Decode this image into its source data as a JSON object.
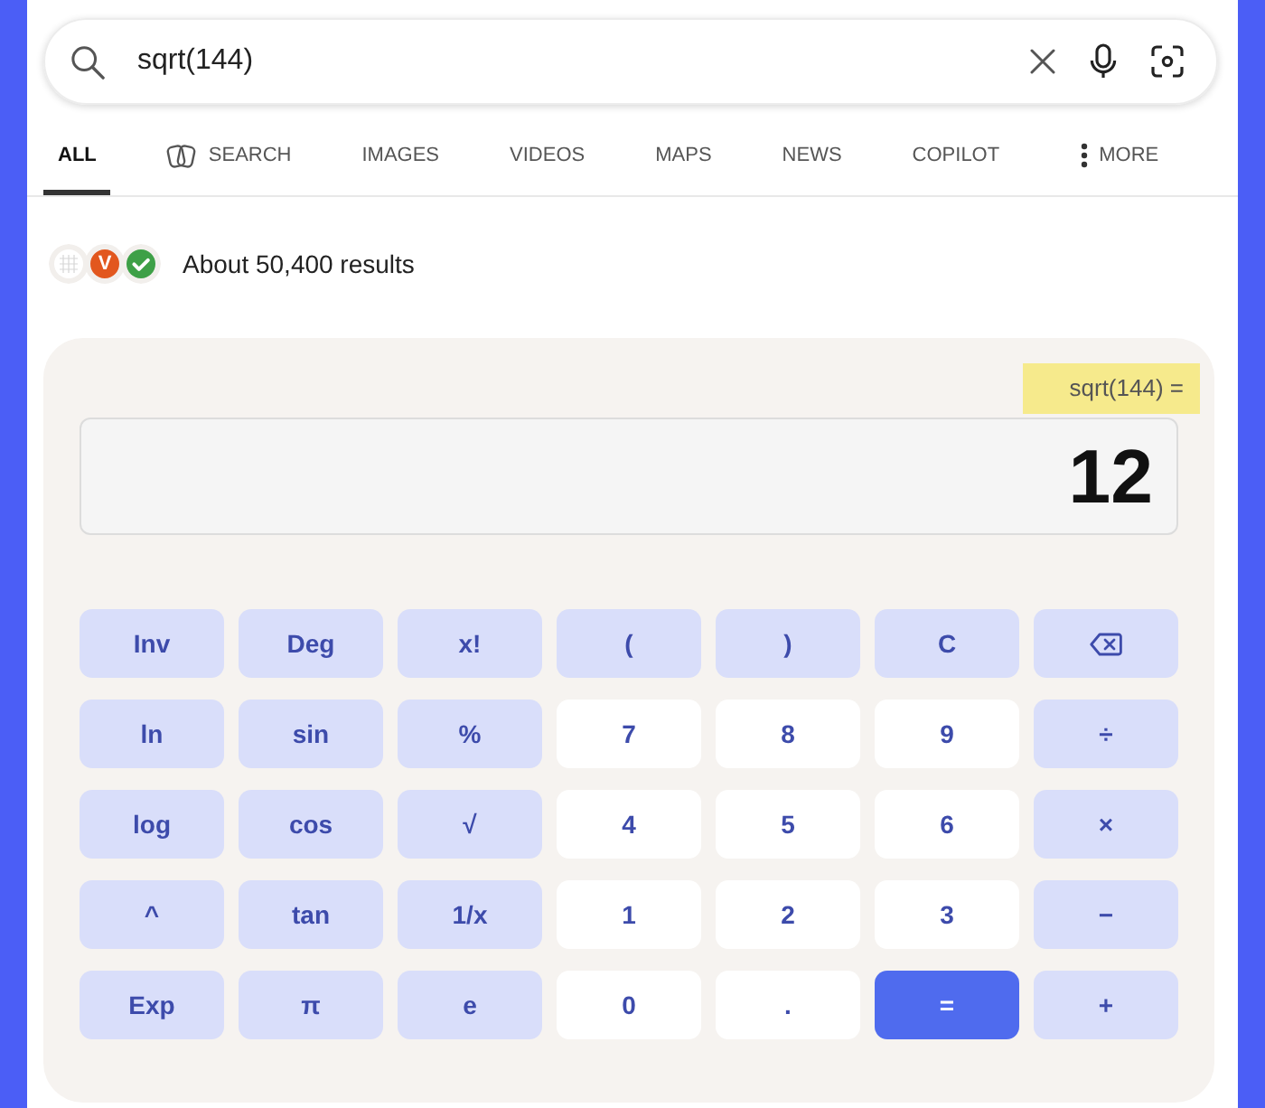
{
  "search": {
    "value": "sqrt(144)"
  },
  "tabs": [
    {
      "label": "ALL",
      "kind": "text",
      "selected": true
    },
    {
      "label": "SEARCH",
      "kind": "search",
      "selected": false
    },
    {
      "label": "IMAGES",
      "kind": "text",
      "selected": false
    },
    {
      "label": "VIDEOS",
      "kind": "text",
      "selected": false
    },
    {
      "label": "MAPS",
      "kind": "text",
      "selected": false
    },
    {
      "label": "NEWS",
      "kind": "text",
      "selected": false
    },
    {
      "label": "COPILOT",
      "kind": "text",
      "selected": false
    },
    {
      "label": "MORE",
      "kind": "more",
      "selected": false
    }
  ],
  "results": {
    "sources": [
      {
        "kind": "grid"
      },
      {
        "kind": "letter",
        "label": "V"
      },
      {
        "kind": "check"
      }
    ],
    "count": "About 50,400 results"
  },
  "calculator": {
    "expression": "sqrt(144) =",
    "result": "12",
    "keys": [
      {
        "label": "Inv",
        "kind": "function"
      },
      {
        "label": "Deg",
        "kind": "function"
      },
      {
        "label": "x!",
        "kind": "function"
      },
      {
        "label": "(",
        "kind": "function"
      },
      {
        "label": ")",
        "kind": "function"
      },
      {
        "label": "C",
        "kind": "function"
      },
      {
        "kind": "backspace"
      },
      {
        "label": "ln",
        "kind": "function"
      },
      {
        "label": "sin",
        "kind": "function"
      },
      {
        "label": "%",
        "kind": "function"
      },
      {
        "label": "7",
        "kind": "digit"
      },
      {
        "label": "8",
        "kind": "digit"
      },
      {
        "label": "9",
        "kind": "digit"
      },
      {
        "label": "÷",
        "kind": "function"
      },
      {
        "label": "log",
        "kind": "function"
      },
      {
        "label": "cos",
        "kind": "function"
      },
      {
        "label": "√",
        "kind": "function"
      },
      {
        "label": "4",
        "kind": "digit"
      },
      {
        "label": "5",
        "kind": "digit"
      },
      {
        "label": "6",
        "kind": "digit"
      },
      {
        "label": "×",
        "kind": "function"
      },
      {
        "label": "^",
        "kind": "function"
      },
      {
        "label": "tan",
        "kind": "function"
      },
      {
        "label": "1/x",
        "kind": "function"
      },
      {
        "label": "1",
        "kind": "digit"
      },
      {
        "label": "2",
        "kind": "digit"
      },
      {
        "label": "3",
        "kind": "digit"
      },
      {
        "label": "−",
        "kind": "function"
      },
      {
        "label": "Exp",
        "kind": "function"
      },
      {
        "label": "π",
        "kind": "function"
      },
      {
        "label": "e",
        "kind": "function"
      },
      {
        "label": "0",
        "kind": "digit"
      },
      {
        "label": ".",
        "kind": "digit"
      },
      {
        "label": "=",
        "kind": "equals"
      },
      {
        "label": "+",
        "kind": "function"
      }
    ]
  }
}
